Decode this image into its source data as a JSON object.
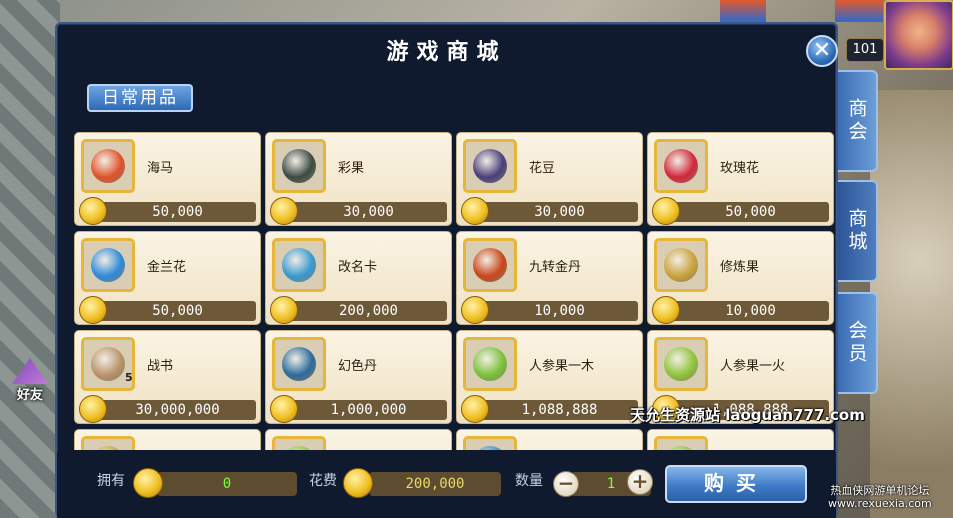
{
  "hud": {
    "level": "101",
    "friend_label": "好友"
  },
  "dialog": {
    "title": "游戏商城",
    "close_symbol": "✕",
    "category_tab": "日常用品",
    "items": [
      {
        "name": "海马",
        "price": "50,000",
        "color": "#e0522a",
        "qty": ""
      },
      {
        "name": "彩果",
        "price": "30,000",
        "color": "#3c4a44",
        "qty": ""
      },
      {
        "name": "花豆",
        "price": "30,000",
        "color": "#4a3f7a",
        "qty": ""
      },
      {
        "name": "玫瑰花",
        "price": "50,000",
        "color": "#d2273a",
        "qty": ""
      },
      {
        "name": "金兰花",
        "price": "50,000",
        "color": "#2f8ad8",
        "qty": ""
      },
      {
        "name": "改名卡",
        "price": "200,000",
        "color": "#3a9ad0",
        "qty": ""
      },
      {
        "name": "九转金丹",
        "price": "10,000",
        "color": "#c8461c",
        "qty": ""
      },
      {
        "name": "修炼果",
        "price": "10,000",
        "color": "#c9a23a",
        "qty": ""
      },
      {
        "name": "战书",
        "price": "30,000,000",
        "color": "#b9936a",
        "qty": "5"
      },
      {
        "name": "幻色丹",
        "price": "1,000,000",
        "color": "#2c6a9c",
        "qty": ""
      },
      {
        "name": "人参果一木",
        "price": "1,088,888",
        "color": "#7ac23a",
        "qty": ""
      },
      {
        "name": "人参果一火",
        "price": "1,088,888",
        "color": "#8fc43a",
        "qty": ""
      },
      {
        "name": "",
        "price": "",
        "color": "#c9a23a",
        "qty": ""
      },
      {
        "name": "",
        "price": "",
        "color": "#8fc43a",
        "qty": ""
      },
      {
        "name": "",
        "price": "",
        "color": "#3a8ad0",
        "qty": ""
      },
      {
        "name": "",
        "price": "",
        "color": "#8fc43a",
        "qty": ""
      }
    ],
    "footer": {
      "own_label": "拥有",
      "own_value": "0",
      "cost_label": "花费",
      "cost_value": "200,000",
      "qty_label": "数量",
      "qty_value": "1",
      "minus": "−",
      "plus": "+",
      "buy_label": "购买"
    }
  },
  "side_tabs": [
    {
      "label": "商会",
      "active": false
    },
    {
      "label": "商城",
      "active": true
    },
    {
      "label": "会员",
      "active": false
    }
  ],
  "watermark": {
    "line1": "天允生资源站 laoguan777.com",
    "line2": "热血侠网游单机论坛",
    "line3": "www.rexuexia.com"
  }
}
